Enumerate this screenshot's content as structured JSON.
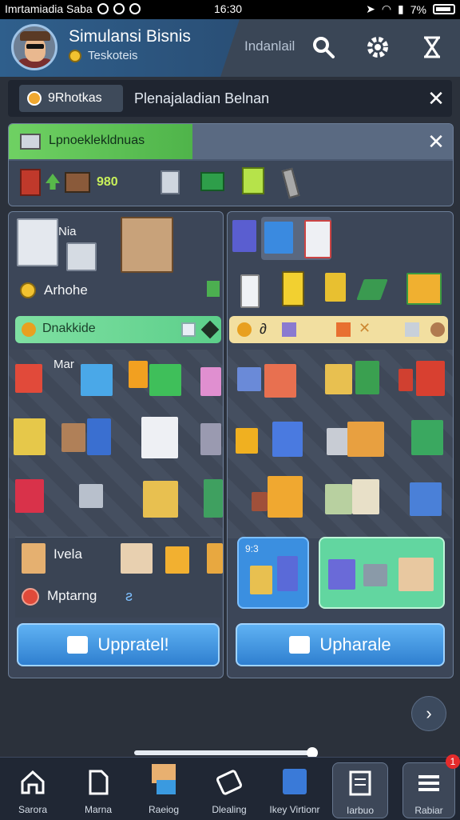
{
  "status_bar": {
    "carrier": "Imrtamiadia Saba",
    "time": "16:30",
    "battery": "7%"
  },
  "header": {
    "title": "Simulansi Bisnis",
    "subtitle": "Teskoteis",
    "label": "Indanlail"
  },
  "tabs": {
    "tab1": "9Rhotkas",
    "tab2": "Plenajaladian Belnan"
  },
  "category": {
    "title": "Lpnoeklekldnuas",
    "price": "980"
  },
  "left_panel": {
    "top_tag": "Nia",
    "stat_label": "Arhohe",
    "pill_label": "Dnakkide",
    "section1": "Mar",
    "row_label1": "Ivela",
    "row_label2": "Mptarng",
    "button": "Uppratel!"
  },
  "right_panel": {
    "tag": "9:3",
    "button": "Upharale"
  },
  "bottom_nav": [
    {
      "label": "Sarora",
      "icon": "home-icon"
    },
    {
      "label": "Marna",
      "icon": "document-icon"
    },
    {
      "label": "Raeiog",
      "icon": "shop-icon"
    },
    {
      "label": "Dlealing",
      "icon": "ticket-icon"
    },
    {
      "label": "Ikey Virtionr",
      "icon": "game-icon"
    },
    {
      "label": "Iarbuo",
      "icon": "news-icon"
    },
    {
      "label": "Rabiar",
      "icon": "menu-icon"
    }
  ],
  "badge": "1",
  "colors": {
    "accent_blue": "#3b8fe0",
    "accent_green": "#6fd163",
    "panel": "#3c4658"
  }
}
